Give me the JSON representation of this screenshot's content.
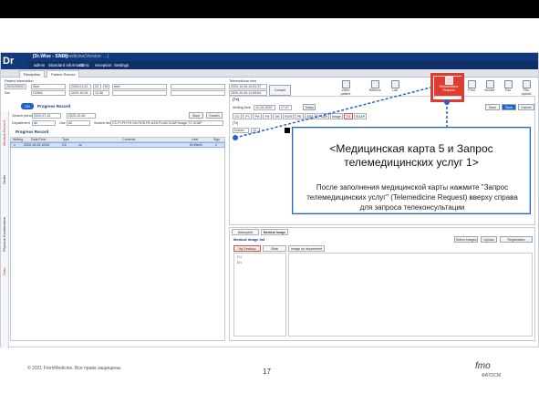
{
  "app": {
    "logo": "Dr",
    "title": "[Dr.Wise - SADI]",
    "subtitle": "Telemedicine(Version: ...)",
    "menu": [
      "admin",
      "Standard information",
      "Clinic",
      "reception",
      "Settings"
    ]
  },
  "tabs": [
    "Reception",
    "Patient Record"
  ],
  "patient_info": {
    "heading": "Patient information",
    "id_label": "ID",
    "id_value": "2020200001",
    "name_value": "Wee",
    "dob_value": "2000-01-01",
    "age_value": "20",
    "sex_value": "M",
    "note_value": "wee",
    "nm_label": "Nm",
    "phone_value": "D2564",
    "date2_value": "2020-10-26",
    "time2_value": "12:36"
  },
  "telemedicine_time": {
    "heading": "Telemedicine time",
    "start_value": "2020-10-26 10:51:37",
    "end_value": "2020-10-26 11:06:54",
    "button": "Consult"
  },
  "toolbar": {
    "items": [
      "Video patient info",
      "Referral",
      "Lab",
      "Telemedicine Request",
      "Print",
      "Worker",
      "Fax",
      "File upload"
    ]
  },
  "progress_record": {
    "toggle": "ON",
    "title": "Progress Record",
    "search_period_label": "Search period",
    "from": "2020-07-15",
    "to": "2020-10-26",
    "department_label": "Department",
    "department_value": "All",
    "use_label": "Use",
    "use_value": "All",
    "search_items_label": "Search items",
    "search_items_value": "CC,PI,PH,FH,SH,ROS,PE,ASS,PLAN,SOAP,Image,TX,SOAP",
    "btn_save": "Save",
    "btn_search": "Search",
    "grid_title": "Progress Record",
    "columns": [
      "Writing",
      "Date/Time",
      "Type",
      "Contents",
      "User",
      "Sign"
    ],
    "rows": [
      [
        "v",
        "2020-10-26 10:51",
        "CC",
        "cc",
        "Dr.Wee1",
        "v"
      ]
    ]
  },
  "rail": [
    "Medical Record",
    "Order",
    "Physical Examination",
    "Data"
  ],
  "tx_panel": {
    "header": "[Tx]",
    "writing_time_label": "Writing time",
    "writing_date": "10-26-2020",
    "writing_time": "17:07",
    "today": "Today",
    "btn_save": "Save",
    "btn_save2": "Save",
    "btn_cancel": "Cancel",
    "subtabs": [
      "CC",
      "PI",
      "PH",
      "FH",
      "SH",
      "ROS",
      "PE",
      "ASS",
      "PLAN",
      "Image",
      "TX",
      "SOAP"
    ],
    "sub_header": "[Tx]",
    "font_label": "Dotum",
    "font_size": "10",
    "bold_label": "Bold"
  },
  "image_panel": {
    "tabs": [
      "Attempted",
      "Medical Image"
    ],
    "list_title": "Medical image list",
    "sub_tabs": [
      "My Desktop",
      "Slide",
      "Image by department"
    ],
    "buttons": [
      "Select Images",
      "Upload",
      "Registration"
    ],
    "tree": [
      "C:\\",
      "D:\\"
    ]
  },
  "callout": {
    "title": "<Медицинская карта 5 и Запрос телемедицинских услуг 1>",
    "body": "После заполнения медицинской карты нажмите \"Запрос телемедицинских услуг\" (Telemedicine Request) вверху справа для запроса телеконсультации"
  },
  "footer": {
    "copyright": "© 2021 FromMedicine. Все права защищены.",
    "page": "17",
    "brand": "fmo",
    "brand_sub": "ФАТОСМ"
  },
  "colors": {
    "brand": "#123a7a",
    "highlight": "#e03b2e",
    "connector": "#1e63c8"
  }
}
